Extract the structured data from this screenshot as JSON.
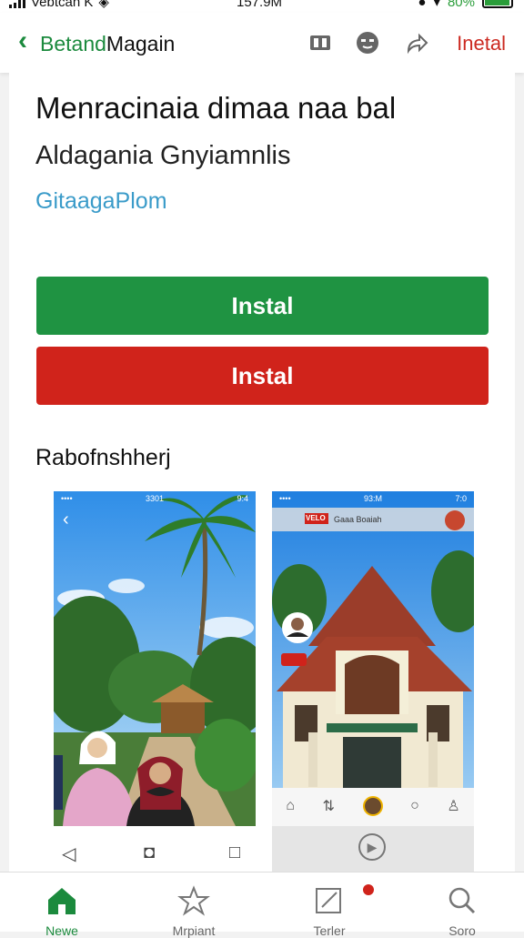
{
  "status_bar": {
    "carrier": "Vebtcan K",
    "time": "157.9M",
    "battery": "80%"
  },
  "app_bar": {
    "back_icon": "chevron-left-icon",
    "title_part1": "Betand",
    "title_part2": "Magain",
    "icons": [
      "book-icon",
      "emoji-icon",
      "share-icon"
    ],
    "install_label": "Inetal"
  },
  "app_detail": {
    "title": "Menracinaia dimaa naa bal",
    "developer": "Aldagania Gnyiamnlis",
    "category_link": "GitaagaPlom",
    "install_button_primary": "Instal",
    "install_button_secondary": "Instal",
    "section_title": "Rabofnshherj"
  },
  "screenshots": [
    {
      "status_left": "••••",
      "status_time": "3301",
      "status_right": "9:4"
    },
    {
      "status_left": "••••",
      "status_time": "93:M",
      "status_right": "7:0",
      "chip_label": "Gaaa Boaiah",
      "tag_label": "VELO"
    }
  ],
  "bottom_nav": [
    {
      "label": "Newe",
      "icon": "home-icon",
      "active": true
    },
    {
      "label": "Mrpiant",
      "icon": "star-icon",
      "active": false
    },
    {
      "label": "Terler",
      "icon": "edit-icon",
      "active": false
    },
    {
      "label": "Soro",
      "icon": "search-icon",
      "active": false
    }
  ],
  "colors": {
    "accent_green": "#1f9342",
    "accent_red": "#d0231b",
    "link_blue": "#3a9bc9"
  }
}
